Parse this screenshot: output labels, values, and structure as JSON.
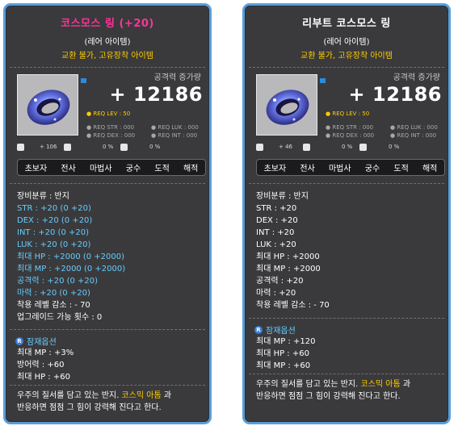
{
  "left": {
    "title": "코스모스 링 (+20)",
    "title_color": "#ff3399",
    "rarity": "(레어 아이템)",
    "restrict": "교환 불가, 고유장착 아이템",
    "atk_label": "공격력 증가량",
    "atk_value": "+ 12186",
    "req_lev": "● REQ LEV :   50",
    "req_str": "● REQ STR : 000",
    "req_luk": "● REQ LUK : 000",
    "req_dex": "● REQ DEX : 000",
    "req_int": "● REQ INT : 000",
    "mini_a": "+ 106",
    "mini_b": "0 %",
    "mini_c": "0 %",
    "jobs": [
      "초보자",
      "전사",
      "마법사",
      "궁수",
      "도적",
      "해적"
    ],
    "stats": [
      {
        "text": "장비분류 : 반지",
        "blue": false
      },
      {
        "text": "STR : +20 (0 +20)",
        "blue": true
      },
      {
        "text": "DEX : +20 (0 +20)",
        "blue": true
      },
      {
        "text": "INT : +20 (0 +20)",
        "blue": true
      },
      {
        "text": "LUK : +20 (0 +20)",
        "blue": true
      },
      {
        "text": "최대 HP : +2000 (0 +2000)",
        "blue": true
      },
      {
        "text": "최대 MP : +2000 (0 +2000)",
        "blue": true
      },
      {
        "text": "공격력 : +20 (0 +20)",
        "blue": true
      },
      {
        "text": "마력 : +20 (0 +20)",
        "blue": true
      },
      {
        "text": "착용 레벨 감소 : - 70",
        "blue": false
      },
      {
        "text": "업그레이드 가능 횟수 : 0",
        "blue": false
      }
    ],
    "potential_title": "잠재옵션",
    "potential": [
      "최대 MP : +3%",
      "방어력 : +60",
      "최대 HP : +60"
    ],
    "desc_pre": "우주의 질서를 담고 있는 반지.",
    "desc_hl": "코스믹 아톰",
    "desc_post": "과",
    "desc_line2": "반응하면 점점 그 힘이 강력해 진다고 한다."
  },
  "right": {
    "title": "리부트 코스모스 링",
    "title_color": "#ffffff",
    "rarity": "(레어 아이템)",
    "restrict": "교환 불가, 고유장착 아이템",
    "atk_label": "공격력 증가량",
    "atk_value": "+ 12186",
    "req_lev": "● REQ LEV :   50",
    "req_str": "● REQ STR : 000",
    "req_luk": "● REQ LUK : 000",
    "req_dex": "● REQ DEX : 000",
    "req_int": "● REQ INT : 000",
    "mini_a": "+ 46",
    "mini_b": "0 %",
    "mini_c": "0 %",
    "jobs": [
      "초보자",
      "전사",
      "마법사",
      "궁수",
      "도적",
      "해적"
    ],
    "stats": [
      {
        "text": "장비분류 : 반지",
        "blue": false
      },
      {
        "text": "STR : +20",
        "blue": false
      },
      {
        "text": "DEX : +20",
        "blue": false
      },
      {
        "text": "INT : +20",
        "blue": false
      },
      {
        "text": "LUK : +20",
        "blue": false
      },
      {
        "text": "최대 HP : +2000",
        "blue": false
      },
      {
        "text": "최대 MP : +2000",
        "blue": false
      },
      {
        "text": "공격력 : +20",
        "blue": false
      },
      {
        "text": "마력 : +20",
        "blue": false
      },
      {
        "text": "착용 레벨 감소 : - 70",
        "blue": false
      }
    ],
    "potential_title": "잠재옵션",
    "potential": [
      "최대 MP : +120",
      "최대 HP : +60",
      "최대 MP : +60"
    ],
    "desc_pre": "우주의 질서를 담고 있는 반지.",
    "desc_hl": "코스믹 아톰",
    "desc_post": "과",
    "desc_line2": "반응하면 점점 그 힘이 강력해 진다고 한다."
  },
  "colors": {
    "panel_bg": "#3a3a3c",
    "border": "#5a9ed8",
    "stat_blue": "#66ccff",
    "highlight": "#ffcc00"
  },
  "icons": {
    "ring": "cosmos-ring-icon",
    "potential": "potential-badge-icon"
  }
}
